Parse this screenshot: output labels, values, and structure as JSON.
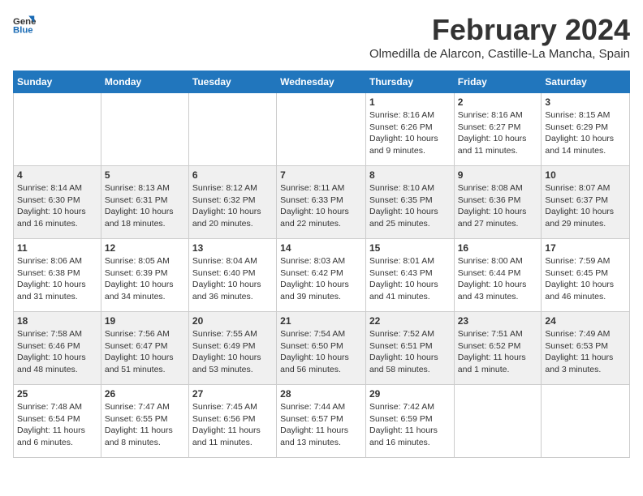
{
  "header": {
    "logo_line1": "General",
    "logo_line2": "Blue",
    "title": "February 2024",
    "subtitle": "Olmedilla de Alarcon, Castille-La Mancha, Spain"
  },
  "weekdays": [
    "Sunday",
    "Monday",
    "Tuesday",
    "Wednesday",
    "Thursday",
    "Friday",
    "Saturday"
  ],
  "weeks": [
    [
      {
        "day": "",
        "detail": ""
      },
      {
        "day": "",
        "detail": ""
      },
      {
        "day": "",
        "detail": ""
      },
      {
        "day": "",
        "detail": ""
      },
      {
        "day": "1",
        "detail": "Sunrise: 8:16 AM\nSunset: 6:26 PM\nDaylight: 10 hours\nand 9 minutes."
      },
      {
        "day": "2",
        "detail": "Sunrise: 8:16 AM\nSunset: 6:27 PM\nDaylight: 10 hours\nand 11 minutes."
      },
      {
        "day": "3",
        "detail": "Sunrise: 8:15 AM\nSunset: 6:29 PM\nDaylight: 10 hours\nand 14 minutes."
      }
    ],
    [
      {
        "day": "4",
        "detail": "Sunrise: 8:14 AM\nSunset: 6:30 PM\nDaylight: 10 hours\nand 16 minutes."
      },
      {
        "day": "5",
        "detail": "Sunrise: 8:13 AM\nSunset: 6:31 PM\nDaylight: 10 hours\nand 18 minutes."
      },
      {
        "day": "6",
        "detail": "Sunrise: 8:12 AM\nSunset: 6:32 PM\nDaylight: 10 hours\nand 20 minutes."
      },
      {
        "day": "7",
        "detail": "Sunrise: 8:11 AM\nSunset: 6:33 PM\nDaylight: 10 hours\nand 22 minutes."
      },
      {
        "day": "8",
        "detail": "Sunrise: 8:10 AM\nSunset: 6:35 PM\nDaylight: 10 hours\nand 25 minutes."
      },
      {
        "day": "9",
        "detail": "Sunrise: 8:08 AM\nSunset: 6:36 PM\nDaylight: 10 hours\nand 27 minutes."
      },
      {
        "day": "10",
        "detail": "Sunrise: 8:07 AM\nSunset: 6:37 PM\nDaylight: 10 hours\nand 29 minutes."
      }
    ],
    [
      {
        "day": "11",
        "detail": "Sunrise: 8:06 AM\nSunset: 6:38 PM\nDaylight: 10 hours\nand 31 minutes."
      },
      {
        "day": "12",
        "detail": "Sunrise: 8:05 AM\nSunset: 6:39 PM\nDaylight: 10 hours\nand 34 minutes."
      },
      {
        "day": "13",
        "detail": "Sunrise: 8:04 AM\nSunset: 6:40 PM\nDaylight: 10 hours\nand 36 minutes."
      },
      {
        "day": "14",
        "detail": "Sunrise: 8:03 AM\nSunset: 6:42 PM\nDaylight: 10 hours\nand 39 minutes."
      },
      {
        "day": "15",
        "detail": "Sunrise: 8:01 AM\nSunset: 6:43 PM\nDaylight: 10 hours\nand 41 minutes."
      },
      {
        "day": "16",
        "detail": "Sunrise: 8:00 AM\nSunset: 6:44 PM\nDaylight: 10 hours\nand 43 minutes."
      },
      {
        "day": "17",
        "detail": "Sunrise: 7:59 AM\nSunset: 6:45 PM\nDaylight: 10 hours\nand 46 minutes."
      }
    ],
    [
      {
        "day": "18",
        "detail": "Sunrise: 7:58 AM\nSunset: 6:46 PM\nDaylight: 10 hours\nand 48 minutes."
      },
      {
        "day": "19",
        "detail": "Sunrise: 7:56 AM\nSunset: 6:47 PM\nDaylight: 10 hours\nand 51 minutes."
      },
      {
        "day": "20",
        "detail": "Sunrise: 7:55 AM\nSunset: 6:49 PM\nDaylight: 10 hours\nand 53 minutes."
      },
      {
        "day": "21",
        "detail": "Sunrise: 7:54 AM\nSunset: 6:50 PM\nDaylight: 10 hours\nand 56 minutes."
      },
      {
        "day": "22",
        "detail": "Sunrise: 7:52 AM\nSunset: 6:51 PM\nDaylight: 10 hours\nand 58 minutes."
      },
      {
        "day": "23",
        "detail": "Sunrise: 7:51 AM\nSunset: 6:52 PM\nDaylight: 11 hours\nand 1 minute."
      },
      {
        "day": "24",
        "detail": "Sunrise: 7:49 AM\nSunset: 6:53 PM\nDaylight: 11 hours\nand 3 minutes."
      }
    ],
    [
      {
        "day": "25",
        "detail": "Sunrise: 7:48 AM\nSunset: 6:54 PM\nDaylight: 11 hours\nand 6 minutes."
      },
      {
        "day": "26",
        "detail": "Sunrise: 7:47 AM\nSunset: 6:55 PM\nDaylight: 11 hours\nand 8 minutes."
      },
      {
        "day": "27",
        "detail": "Sunrise: 7:45 AM\nSunset: 6:56 PM\nDaylight: 11 hours\nand 11 minutes."
      },
      {
        "day": "28",
        "detail": "Sunrise: 7:44 AM\nSunset: 6:57 PM\nDaylight: 11 hours\nand 13 minutes."
      },
      {
        "day": "29",
        "detail": "Sunrise: 7:42 AM\nSunset: 6:59 PM\nDaylight: 11 hours\nand 16 minutes."
      },
      {
        "day": "",
        "detail": ""
      },
      {
        "day": "",
        "detail": ""
      }
    ]
  ]
}
